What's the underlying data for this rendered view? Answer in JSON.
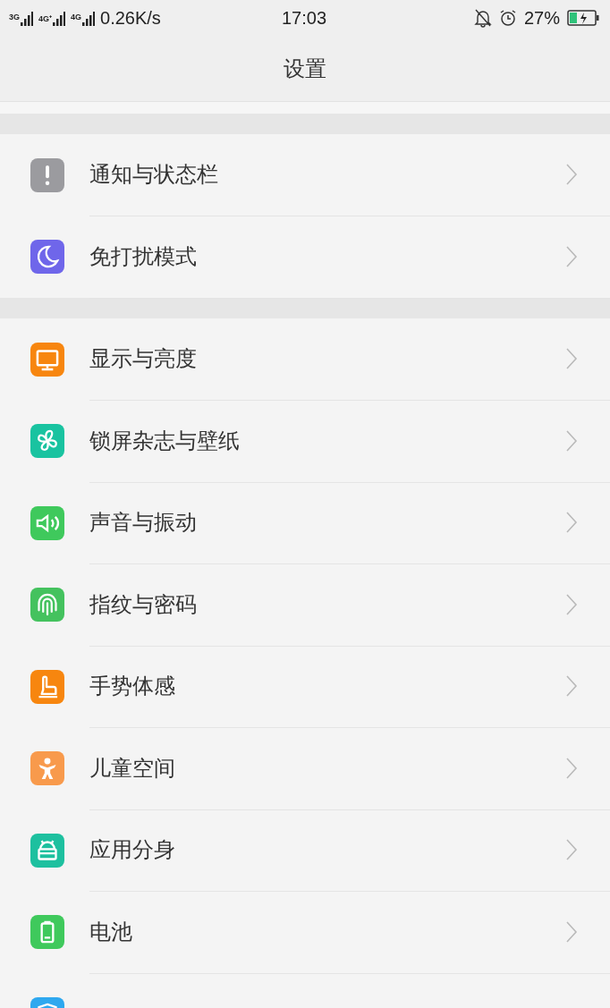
{
  "status_bar": {
    "networks": [
      "3G",
      "4G⁺",
      "4G"
    ],
    "speed": "0.26K/s",
    "time": "17:03",
    "battery": "27%"
  },
  "header": {
    "title": "设置"
  },
  "sections": [
    {
      "items": [
        {
          "label": "通知与状态栏",
          "kind": "alert",
          "color": "#9b9b9f"
        },
        {
          "label": "免打扰模式",
          "kind": "moon",
          "color": "#6f66ea"
        }
      ]
    },
    {
      "items": [
        {
          "label": "显示与亮度",
          "kind": "monitor",
          "color": "#f7860f"
        },
        {
          "label": "锁屏杂志与壁纸",
          "kind": "pinwheel",
          "color": "#19c3a0"
        },
        {
          "label": "声音与振动",
          "kind": "speaker",
          "color": "#3fc95c"
        },
        {
          "label": "指纹与密码",
          "kind": "fingerprint",
          "color": "#44c25e"
        },
        {
          "label": "手势体感",
          "kind": "hand",
          "color": "#f7860f"
        },
        {
          "label": "儿童空间",
          "kind": "child",
          "color": "#f89a4c"
        },
        {
          "label": "应用分身",
          "kind": "robot",
          "color": "#1dc09f"
        },
        {
          "label": "电池",
          "kind": "battery",
          "color": "#3fc95c"
        },
        {
          "kind": "shield",
          "color": "#2ea8ef"
        }
      ]
    }
  ]
}
